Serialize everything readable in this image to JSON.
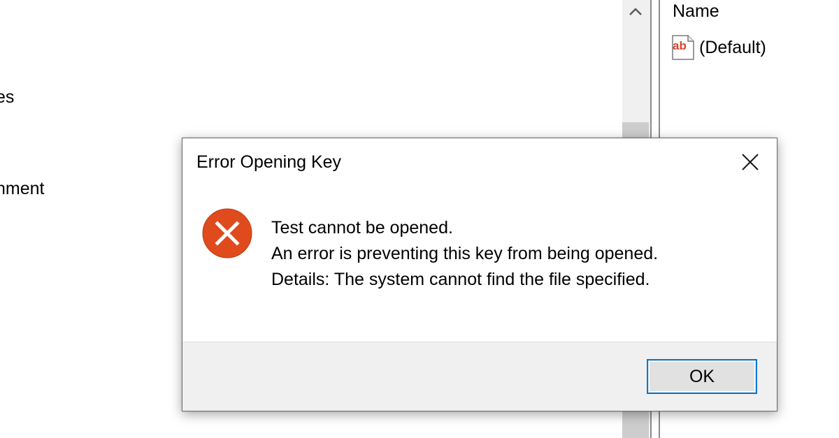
{
  "background_window": {
    "tree": {
      "items": [
        {
          "label": "es"
        },
        {
          "label": "nment"
        }
      ]
    },
    "list": {
      "column_header": "Name",
      "rows": [
        {
          "icon": "reg-string-icon",
          "name": "(Default)"
        }
      ]
    }
  },
  "dialog": {
    "title": "Error Opening Key",
    "icon": "error-icon",
    "messages": [
      "Test cannot be opened.",
      "An error is preventing this key from being opened.",
      "Details: The system cannot find the file specified."
    ],
    "ok_label": "OK"
  },
  "colors": {
    "error_red": "#e04b1e",
    "focus_blue": "#0078d7",
    "footer_bg": "#f0f0f0"
  }
}
